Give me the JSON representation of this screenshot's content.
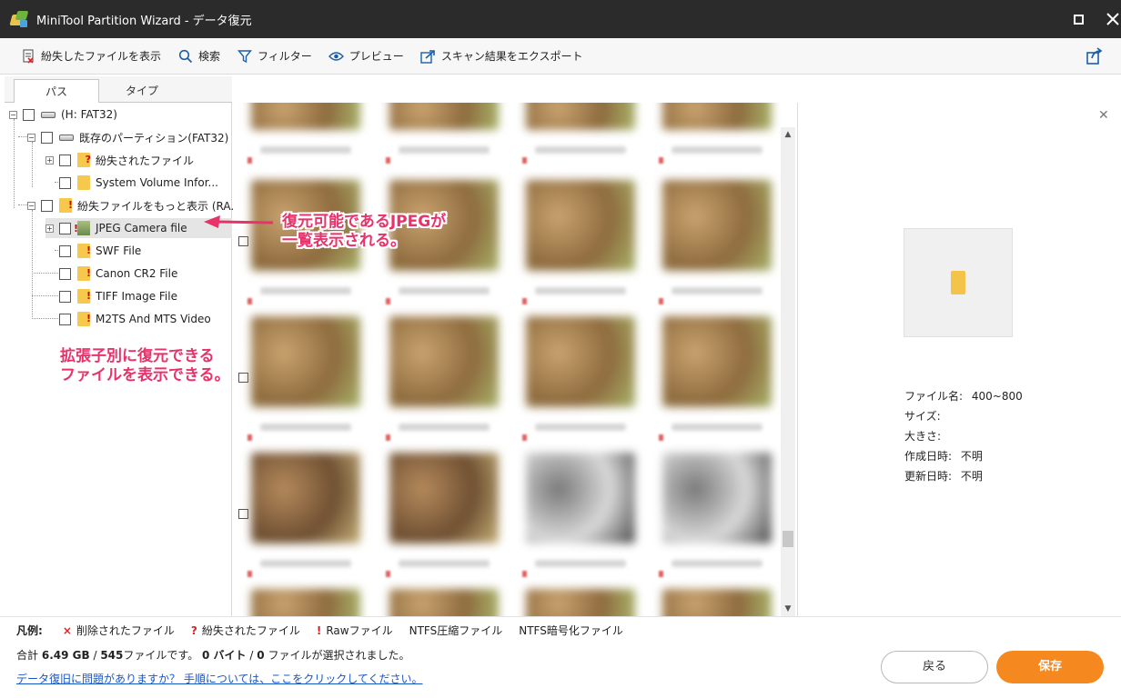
{
  "window": {
    "app_title": "MiniTool Partition Wizard - データ復元"
  },
  "toolbar": {
    "show_lost": "紛失したファイルを表示",
    "search": "検索",
    "filter": "フィルター",
    "preview": "プレビュー",
    "export": "スキャン結果をエクスポート"
  },
  "tabs": [
    {
      "label": "パス"
    },
    {
      "label": "タイプ"
    }
  ],
  "tree": {
    "root": "(H: FAT32)",
    "existing": "既存のパーティション(FAT32)",
    "lost_files": "紛失されたファイル",
    "sysvol": "System Volume Infor...",
    "more_lost": "紛失ファイルをもっと表示 (RA...",
    "jpeg": "JPEG Camera file",
    "swf": "SWF File",
    "cr2": "Canon CR2 File",
    "tiff": "TIFF Image File",
    "m2ts": "M2TS And MTS Video"
  },
  "annotations": {
    "jpeg_line1": "復元可能であるJPEGが",
    "jpeg_line2": "一覧表示される。",
    "ext_line1": "拡張子別に復元できる",
    "ext_line2": "ファイルを表示できる。"
  },
  "preview": {
    "filename_label": "ファイル名:",
    "filename_value": "400~800",
    "size_label": "サイズ:",
    "dimensions_label": "大きさ:",
    "created_label": "作成日時:",
    "created_value": "不明",
    "modified_label": "更新日時:",
    "modified_value": "不明"
  },
  "legend": {
    "title": "凡例:",
    "deleted": "削除されたファイル",
    "lost": "紛失されたファイル",
    "raw": "Rawファイル",
    "ntfs_comp": "NTFS圧縮ファイル",
    "ntfs_enc": "NTFS暗号化ファイル"
  },
  "summary": {
    "prefix": "合計",
    "total_size": "6.49 GB",
    "sep1": "/",
    "file_count": "545",
    "mid": "ファイルです。",
    "selected_size": "0 バイト",
    "sep2": "/",
    "selected_count": "0",
    "suffix": "ファイルが選択されました。"
  },
  "help_link": "データ復旧に問題がありますか？ 手順については、ここをクリックしてください。",
  "buttons": {
    "back": "戻る",
    "save": "保存"
  },
  "colors": {
    "accent_orange": "#f5891f",
    "annotation_pink": "#e8336a",
    "link_blue": "#1a55c8"
  }
}
